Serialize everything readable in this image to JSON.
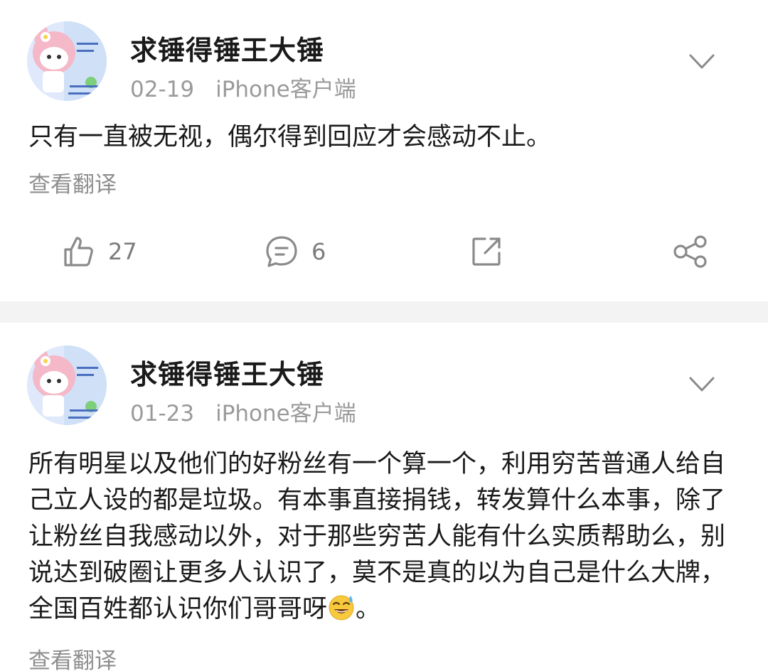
{
  "posts": [
    {
      "username": "求锤得锤王大锤",
      "date": "02-19",
      "source": "iPhone客户端",
      "content": "只有一直被无视，偶尔得到回应才会感动不止。",
      "translate_label": "查看翻译",
      "likes": "27",
      "comments": "6"
    },
    {
      "username": "求锤得锤王大锤",
      "date": "01-23",
      "source": "iPhone客户端",
      "content": "所有明星以及他们的好粉丝有一个算一个，利用穷苦普通人给自己立人设的都是垃圾。有本事直接捐钱，转发算什么本事，除了让粉丝自我感动以外，对于那些穷苦人能有什么实质帮助么，别说达到破圈让更多人认识了，莫不是真的以为自己是什么大牌，全国百姓都认识你们哥哥呀",
      "content_end": "。",
      "emoji": "sweat-smile-emoji",
      "translate_label": "查看翻译"
    }
  ],
  "icons": {
    "more": "chevron-down-icon",
    "like": "thumbs-up-icon",
    "comment": "comment-icon",
    "repost": "repost-icon",
    "share": "share-icon"
  },
  "colors": {
    "text": "#1a1a1a",
    "meta": "#9a9a9a",
    "icon": "#7c7c7c",
    "divider": "#f3f3f3"
  }
}
